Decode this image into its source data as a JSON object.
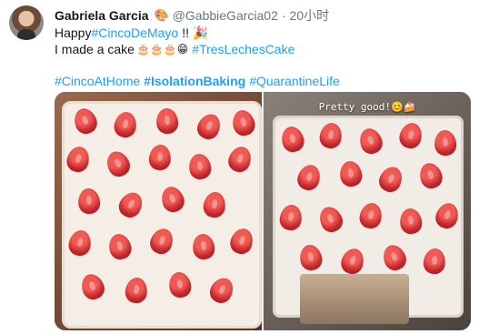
{
  "tweet": {
    "author_name": "Gabriela Garcia",
    "author_emoji": "🎨",
    "handle": "@GabbieGarcia02",
    "separator": "·",
    "timestamp": "20小时",
    "line1_text": "Happy ",
    "line1_tag": "#CincoDeMayo",
    "line1_suffix": " !! 🎉",
    "line2_text": "I made a cake ",
    "line2_emoji": "🎂🎂🎂😁",
    "line2_tag": "#TresLechesCake",
    "tags": [
      "#CincoAtHome",
      "#IsolationBaking",
      "#QuarantineLife"
    ]
  },
  "media": {
    "right_overlay_text": "Pretty good!😊🍰"
  },
  "colors": {
    "link": "#1da1f2",
    "text": "#14171a",
    "muted": "#657786"
  }
}
